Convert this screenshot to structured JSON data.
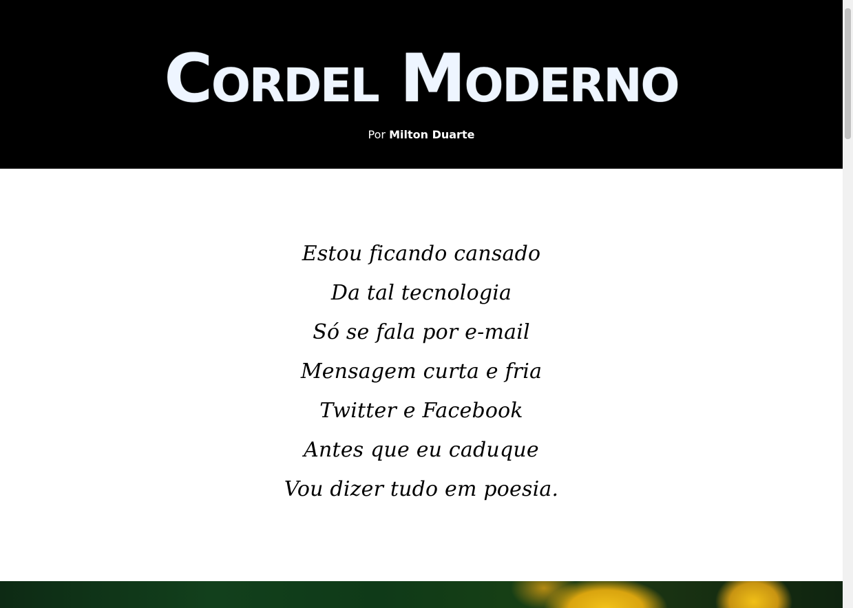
{
  "header": {
    "title": "Cordel Moderno",
    "byline_prefix": "Por",
    "author": "Milton Duarte"
  },
  "poem": {
    "lines": [
      "Estou ficando cansado",
      "Da tal tecnologia",
      "Só se fala por e-mail",
      "Mensagem curta e fria",
      "Twitter e Facebook",
      "Antes que eu caduque",
      "Vou dizer tudo em poesia."
    ]
  },
  "colors": {
    "header_background": "#000000",
    "title_color": "#eef5ff",
    "text_color": "#000000"
  }
}
